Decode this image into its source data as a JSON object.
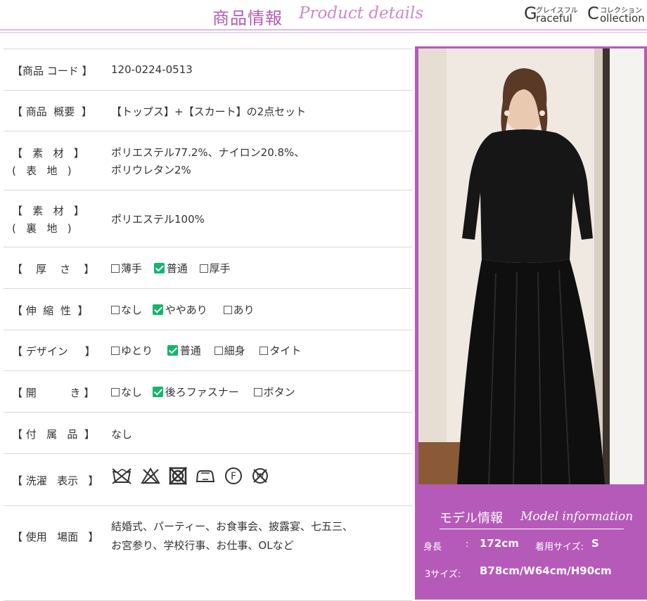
{
  "header": {
    "title_jp": "商品情報",
    "title_en": "Product details",
    "logo": {
      "g": "G",
      "raceful": "raceful",
      "kana_left": "グレイスフル",
      "c": "C",
      "ollection": "ollection",
      "kana_right": "コレクション"
    }
  },
  "specs": [
    {
      "label": "【商品 コード 】",
      "lines": [
        "120-0224-0513"
      ]
    },
    {
      "label": "【 商品  概要  】",
      "lines": [
        "【トップス】+【スカート】の2点セット"
      ]
    },
    {
      "label": "【   素   材   】\n(   表   地   )",
      "lines": [
        "ポリエステル77.2%、ナイロン20.8%、",
        "ポリウレタン2%"
      ]
    },
    {
      "label": "【   素   材   】\n(   裏   地   )",
      "lines": [
        "ポリエステル100%"
      ]
    },
    {
      "label": "【    厚    さ    】",
      "options": [
        {
          "text": "薄手",
          "checked": false
        },
        {
          "text": "普通",
          "checked": true
        },
        {
          "text": "厚手",
          "checked": false
        }
      ]
    },
    {
      "label": "【 伸  縮  性  】",
      "options": [
        {
          "text": "なし",
          "checked": false
        },
        {
          "text": "ややあり",
          "checked": true
        },
        {
          "text": "あり",
          "checked": false
        }
      ]
    },
    {
      "label": "【 デザイン     】",
      "options": [
        {
          "text": "ゆとり",
          "checked": false
        },
        {
          "text": "普通",
          "checked": true
        },
        {
          "text": "細身",
          "checked": false
        },
        {
          "text": "タイト",
          "checked": false
        }
      ]
    },
    {
      "label": "【 開          き 】",
      "options": [
        {
          "text": "なし",
          "checked": false
        },
        {
          "text": "後ろファスナー",
          "checked": true
        },
        {
          "text": "ボタン",
          "checked": false
        }
      ]
    },
    {
      "label": "【 付   属   品  】",
      "lines": [
        "なし"
      ]
    },
    {
      "label": "【 洗濯   表示   】",
      "wash_icons": [
        "no-washing-icon",
        "no-bleach-icon",
        "no-tumble-dry-icon",
        "iron-low-icon",
        "dry-clean-f-icon",
        "no-wet-clean-icon"
      ]
    },
    {
      "label": "【 使用   場面   】",
      "lines": [
        "結婚式、パーティー、お食事会、披露宴、七五三、",
        "お宮参り、学校行事、お仕事、OLなど"
      ]
    }
  ],
  "model": {
    "title_jp": "モデル情報",
    "title_en": "Model information",
    "height_label": "身長",
    "colon": ":",
    "height_value": "172cm",
    "size_label": "着用サイズ:",
    "size_value": "S",
    "three_size_label": "3サイズ:",
    "three_size_value": "B78cm/W64cm/H90cm"
  },
  "colors": {
    "accent": "#b55ab9",
    "check": "#12b76a",
    "rule": "#d9d9d9"
  }
}
